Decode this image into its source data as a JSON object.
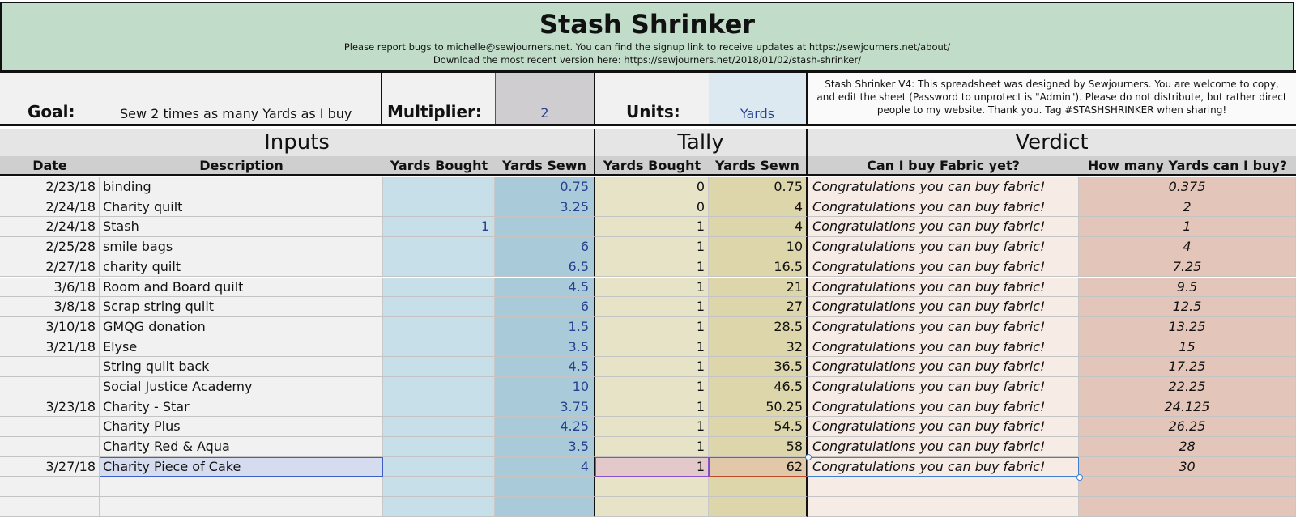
{
  "banner": {
    "title": "Stash Shrinker",
    "line1": "Please report bugs to michelle@sewjourners.net. You can find the signup link to receive updates at https://sewjourners.net/about/",
    "line2": "Download the most recent version here: https://sewjourners.net/2018/01/02/stash-shrinker/"
  },
  "goal": {
    "label": "Goal:",
    "value": "Sew 2 times as many Yards as I buy",
    "multiplier_label": "Multiplier:",
    "multiplier_value": "2",
    "units_label": "Units:",
    "units_value": "Yards",
    "notes": "Stash Shrinker V4: This spreadsheet was designed by Sewjourners. You are welcome to copy, and edit the sheet (Password to unprotect is \"Admin\"). Please do not distribute, but rather direct people to my website. Thank you. Tag #STASHSHRINKER when sharing!"
  },
  "sections": {
    "inputs": "Inputs",
    "tally": "Tally",
    "verdict": "Verdict"
  },
  "columns": {
    "date": "Date",
    "description": "Description",
    "yards_bought": "Yards Bought",
    "yards_sewn": "Yards Sewn",
    "tally_bought": "Yards Bought",
    "tally_sewn": "Yards Sewn",
    "can_buy": "Can I buy Fabric yet?",
    "how_many": "How many Yards can I buy?"
  },
  "rows": [
    {
      "date": "2/23/18",
      "desc": "binding",
      "yb": "",
      "ys": "0.75",
      "tb": "0",
      "ts": "0.75",
      "can": "Congratulations you can buy fabric!",
      "many": "0.375"
    },
    {
      "date": "2/24/18",
      "desc": "Charity quilt",
      "yb": "",
      "ys": "3.25",
      "tb": "0",
      "ts": "4",
      "can": "Congratulations you can buy fabric!",
      "many": "2"
    },
    {
      "date": "2/24/18",
      "desc": "Stash",
      "yb": "1",
      "ys": "",
      "tb": "1",
      "ts": "4",
      "can": "Congratulations you can buy fabric!",
      "many": "1"
    },
    {
      "date": "2/25/28",
      "desc": "smile bags",
      "yb": "",
      "ys": "6",
      "tb": "1",
      "ts": "10",
      "can": "Congratulations you can buy fabric!",
      "many": "4"
    },
    {
      "date": "2/27/18",
      "desc": "charity quilt",
      "yb": "",
      "ys": "6.5",
      "tb": "1",
      "ts": "16.5",
      "can": "Congratulations you can buy fabric!",
      "many": "7.25"
    },
    {
      "date": "3/6/18",
      "desc": "Room and Board quilt",
      "yb": "",
      "ys": "4.5",
      "tb": "1",
      "ts": "21",
      "can": "Congratulations you can buy fabric!",
      "many": "9.5"
    },
    {
      "date": "3/8/18",
      "desc": "Scrap string quilt",
      "yb": "",
      "ys": "6",
      "tb": "1",
      "ts": "27",
      "can": "Congratulations you can buy fabric!",
      "many": "12.5"
    },
    {
      "date": "3/10/18",
      "desc": "GMQG donation",
      "yb": "",
      "ys": "1.5",
      "tb": "1",
      "ts": "28.5",
      "can": "Congratulations you can buy fabric!",
      "many": "13.25"
    },
    {
      "date": "3/21/18",
      "desc": "Elyse",
      "yb": "",
      "ys": "3.5",
      "tb": "1",
      "ts": "32",
      "can": "Congratulations you can buy fabric!",
      "many": "15"
    },
    {
      "date": "",
      "desc": "String quilt back",
      "yb": "",
      "ys": "4.5",
      "tb": "1",
      "ts": "36.5",
      "can": "Congratulations you can buy fabric!",
      "many": "17.25"
    },
    {
      "date": "",
      "desc": "Social Justice Academy",
      "yb": "",
      "ys": "10",
      "tb": "1",
      "ts": "46.5",
      "can": "Congratulations you can buy fabric!",
      "many": "22.25"
    },
    {
      "date": "3/23/18",
      "desc": "Charity - Star",
      "yb": "",
      "ys": "3.75",
      "tb": "1",
      "ts": "50.25",
      "can": "Congratulations you can buy fabric!",
      "many": "24.125"
    },
    {
      "date": "",
      "desc": "Charity Plus",
      "yb": "",
      "ys": "4.25",
      "tb": "1",
      "ts": "54.5",
      "can": "Congratulations you can buy fabric!",
      "many": "26.25"
    },
    {
      "date": "",
      "desc": "Charity Red & Aqua",
      "yb": "",
      "ys": "3.5",
      "tb": "1",
      "ts": "58",
      "can": "Congratulations you can buy fabric!",
      "many": "28"
    },
    {
      "date": "3/27/18",
      "desc": "Charity Piece of Cake",
      "yb": "",
      "ys": "4",
      "tb": "1",
      "ts": "62",
      "can": "Congratulations you can buy fabric!",
      "many": "30"
    },
    {
      "date": "",
      "desc": "",
      "yb": "",
      "ys": "",
      "tb": "",
      "ts": "",
      "can": "",
      "many": ""
    },
    {
      "date": "",
      "desc": "",
      "yb": "",
      "ys": "",
      "tb": "",
      "ts": "",
      "can": "",
      "many": ""
    }
  ]
}
